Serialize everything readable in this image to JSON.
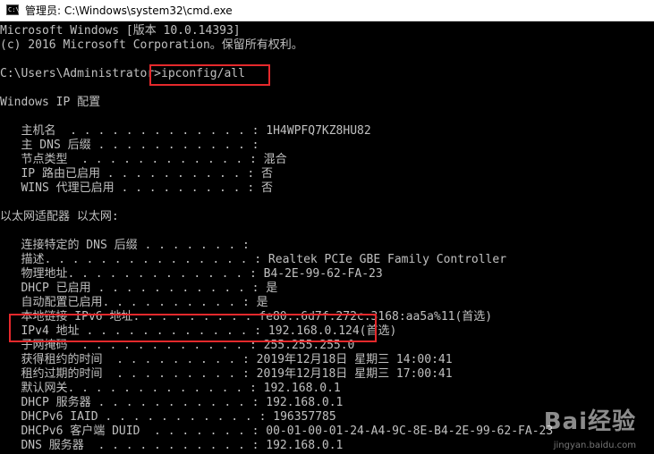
{
  "window": {
    "title": "管理员: C:\\Windows\\system32\\cmd.exe"
  },
  "console": {
    "lines": [
      "Microsoft Windows [版本 10.0.14393]",
      "(c) 2016 Microsoft Corporation。保留所有权利。",
      "",
      "C:\\Users\\Administrator>ipconfig/all",
      "",
      "Windows IP 配置",
      "",
      "   主机名  . . . . . . . . . . . . . : 1H4WPFQ7KZ8HU82",
      "   主 DNS 后缀 . . . . . . . . . . . :",
      "   节点类型  . . . . . . . . . . . . : 混合",
      "   IP 路由已启用 . . . . . . . . . . : 否",
      "   WINS 代理已启用 . . . . . . . . . : 否",
      "",
      "以太网适配器 以太网:",
      "",
      "   连接特定的 DNS 后缀 . . . . . . . :",
      "   描述. . . . . . . . . . . . . . . : Realtek PCIe GBE Family Controller",
      "   物理地址. . . . . . . . . . . . . : B4-2E-99-62-FA-23",
      "   DHCP 已启用 . . . . . . . . . . . : 是",
      "   自动配置已启用. . . . . . . . . . : 是",
      "   本地链接 IPv6 地址. . . . . . . . : fe80::6d7f:272c:3168:aa5a%11(首选)",
      "   IPv4 地址 . . . . . . . . . . . . : 192.168.0.124(首选)",
      "   子网掩码  . . . . . . . . . . . . : 255.255.255.0",
      "   获得租约的时间  . . . . . . . . . : 2019年12月18日 星期三 14:00:41",
      "   租约过期的时间  . . . . . . . . . : 2019年12月18日 星期三 17:00:41",
      "   默认网关. . . . . . . . . . . . . : 192.168.0.1",
      "   DHCP 服务器 . . . . . . . . . . . : 192.168.0.1",
      "   DHCPv6 IAID . . . . . . . . . . . : 196357785",
      "   DHCPv6 客户端 DUID  . . . . . . . : 00-01-00-01-24-A4-9C-8E-B4-2E-99-62-FA-23",
      "   DNS 服务器  . . . . . . . . . . . : 192.168.0.1"
    ]
  },
  "watermark": {
    "brand": "Bai经验",
    "url": "jingyan.baidu.com"
  },
  "colors": {
    "console_bg": "#000000",
    "console_fg": "#c0c0c0",
    "highlight": "#e5292c"
  }
}
